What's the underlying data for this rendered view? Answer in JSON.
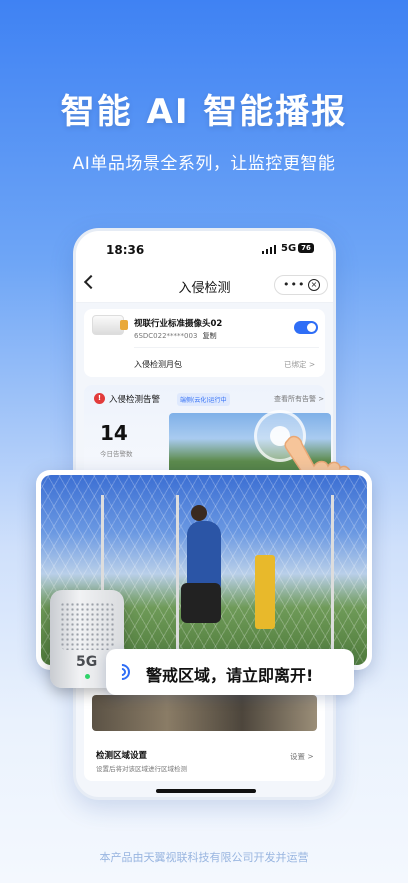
{
  "hero": {
    "title": "智能 AI 智能播报",
    "subtitle": "AI单品场景全系列，让监控更智能"
  },
  "status_bar": {
    "time": "18:36",
    "network": "5G",
    "battery": "76"
  },
  "nav": {
    "title": "入侵检测",
    "more_icon": "more-icon",
    "close_icon": "close-icon"
  },
  "device": {
    "name": "视联行业标准摄像头02",
    "serial": "6SDC022*****003",
    "copy_label": "复制",
    "enabled": true,
    "plan_label": "入侵检测月包",
    "plan_status": "已绑定 >"
  },
  "alert": {
    "title": "入侵检测告警",
    "mode_badge": "端侧(云化)运行中",
    "view_all": "查看所有告警 >",
    "count": "14",
    "count_label": "今日告警数"
  },
  "area": {
    "title": "检测区域设置",
    "subtitle": "设置后将对该区域进行区域检测",
    "link": "设置 >"
  },
  "device_5g_label": "5G",
  "warning_text": "警戒区域，请立即离开!",
  "footer": "本产品由天翼视联科技有限公司开发并运营",
  "colors": {
    "accent": "#2f6ef6",
    "alert": "#e23b3b",
    "bg_top": "#3f82f3"
  }
}
